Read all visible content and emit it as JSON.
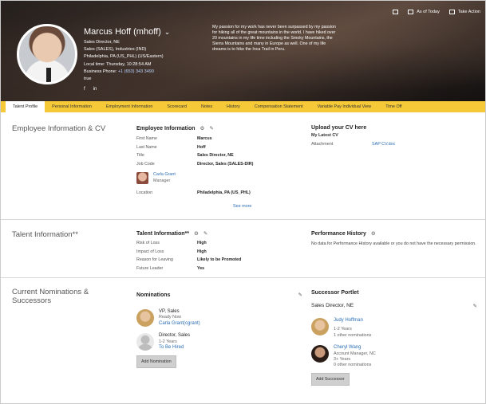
{
  "header": {
    "name": "Marcus Hoff (mhoff)",
    "details": [
      "Sales Director, NE",
      "Sales (SALES), Industries (IND)",
      "Philadelphia, PA (US_PHL) (US/Eastern)",
      "Local time: Thursday, 10:28:54 AM"
    ],
    "phone_label": "Business Phone: ",
    "phone_value": "+1 (653) 343 3490",
    "extra": "true",
    "social": [
      "f",
      "in"
    ],
    "bio": "My passion for my work has never been surpassed by my passion for hiking all of the great mountains in the world. I have hiked over 20 mountains in my life time including the Smoky Mountains, the Sierra Mountains and many in Europe as well. One of my life dreams is to hike the Inca Trail in Peru.",
    "actions": {
      "as_of_today": "As of Today",
      "take_action": "Take Action"
    }
  },
  "tabs": [
    "Talent Profile",
    "Personal Information",
    "Employment Information",
    "Scorecard",
    "Notes",
    "History",
    "Compensation Statement",
    "Variable Pay Individual View",
    "Time Off"
  ],
  "employee_section": {
    "title": "Employee Information & CV",
    "info_title": "Employee Information",
    "fields": [
      {
        "label": "First Name",
        "value": "Marcus"
      },
      {
        "label": "Last Name",
        "value": "Hoff"
      },
      {
        "label": "Title",
        "value": "Sales Director, NE"
      },
      {
        "label": "Job Code",
        "value": "Director, Sales (SALES-DIR)"
      }
    ],
    "manager_name": "Carla Grant",
    "manager_role": "Manager",
    "location_label": "Location",
    "location_value": "Philadelphia, PA (US_PHL)",
    "see_more": "See more",
    "cv_title": "Upload your CV here",
    "cv_sub": "My Latest CV",
    "attachment_label": "Attachment",
    "attachment_value": "SAP CV.doc"
  },
  "talent_section": {
    "title": "Talent Information**",
    "info_title": "Talent Information**",
    "fields": [
      {
        "label": "Risk of Loss",
        "value": "High"
      },
      {
        "label": "Impact of Loss",
        "value": "High"
      },
      {
        "label": "Reason for Leaving",
        "value": "Likely to be Promoted"
      },
      {
        "label": "Future Leader",
        "value": "Yes"
      }
    ],
    "perf_title": "Performance History",
    "perf_text": "No data for Performance History available or you do not have the necessary permission."
  },
  "nominations_section": {
    "title": "Current Nominations & Successors",
    "nominations_title": "Nominations",
    "nominations": [
      {
        "title": "VP, Sales",
        "status": "Ready Now",
        "name": "Carla Grant(cgrant)"
      },
      {
        "title": "Director, Sales",
        "status": "1-2 Years",
        "name": "To Be Hired"
      }
    ],
    "add_nomination": "Add Nomination",
    "successor_title": "Successor Portlet",
    "successor_position": "Sales Director, NE",
    "successors": [
      {
        "name": "Judy Hoffman",
        "lines": [
          "1-2 Years",
          "1 other nominations"
        ]
      },
      {
        "name": "Cheryl Wang",
        "lines": [
          "Account Manager, NC",
          "3+ Years",
          "0 other nominations"
        ]
      }
    ],
    "add_successor": "Add Successor"
  }
}
